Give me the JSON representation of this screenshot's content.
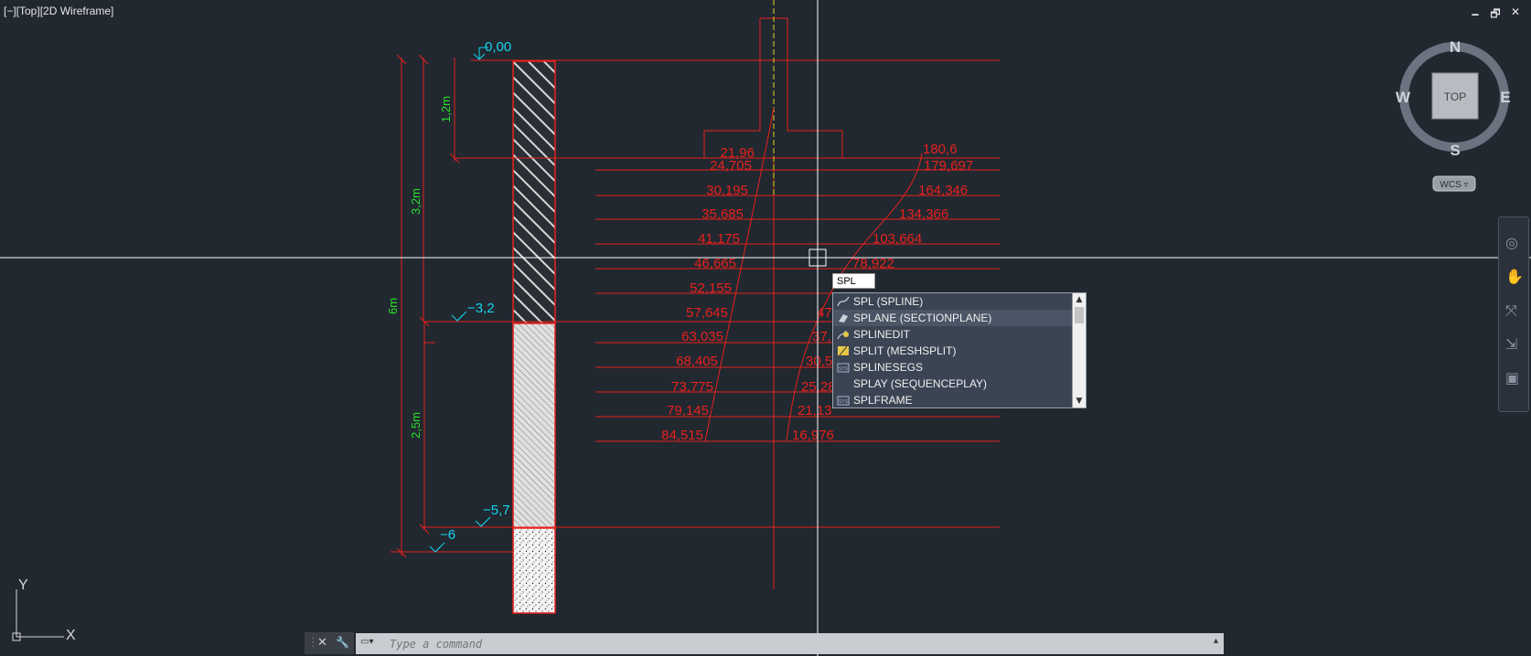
{
  "viewport": {
    "label": "[−][Top][2D Wireframe]"
  },
  "window_controls": {
    "minimize": "🗕",
    "restore": "🗗",
    "close": "✕"
  },
  "viewcube": {
    "north": "N",
    "south": "S",
    "east": "E",
    "west": "W",
    "face": "TOP",
    "wcs": "WCS ▿"
  },
  "ucs": {
    "x": "X",
    "y": "Y"
  },
  "drawing": {
    "colors": {
      "bg": "#212830",
      "red": "#e8211c",
      "cyan": "#14d4f0",
      "green": "#27e027",
      "yellow": "#e6d21a",
      "white": "#ffffff"
    },
    "elevations": [
      "0,00",
      "−3,2",
      "−5,7",
      "−6"
    ],
    "dimensions": [
      "1,2m",
      "3,2m",
      "6m",
      "2,5m"
    ],
    "left_values": [
      "21,96",
      "24,705",
      "30,195",
      "35,685",
      "41,175",
      "46,665",
      "52,155",
      "57,645",
      "63,035",
      "68,405",
      "73,775",
      "79,145",
      "84,515"
    ],
    "right_values": [
      "180,6",
      "179,697",
      "164,346",
      "134,366",
      "103,664",
      "78,922",
      "47",
      "37,",
      "30,5",
      "25,28",
      "21,13",
      "16,976"
    ]
  },
  "autocomplete": {
    "input": "SPL",
    "items": [
      {
        "label": "SPL (SPLINE)",
        "icon": "spline-icon"
      },
      {
        "label": "SPLANE (SECTIONPLANE)",
        "icon": "sectionplane-icon"
      },
      {
        "label": "SPLINEDIT",
        "icon": "splinedit-icon"
      },
      {
        "label": "SPLIT (MESHSPLIT)",
        "icon": "meshsplit-icon"
      },
      {
        "label": "SPLINESEGS",
        "icon": "sysvar-icon"
      },
      {
        "label": "SPLAY (SEQUENCEPLAY)",
        "icon": ""
      },
      {
        "label": "SPLFRAME",
        "icon": "sysvar-icon"
      }
    ],
    "scroll_up": "▲",
    "scroll_down": "▼"
  },
  "commandline": {
    "placeholder": "Type a command",
    "close_icon": "✕",
    "settings_icon": "🔧",
    "prompt_icon": "▭▾",
    "history_icon": "▴"
  },
  "navbar": {
    "icons": [
      "◎",
      "✋",
      "⤧",
      "⇲",
      "▣"
    ]
  }
}
